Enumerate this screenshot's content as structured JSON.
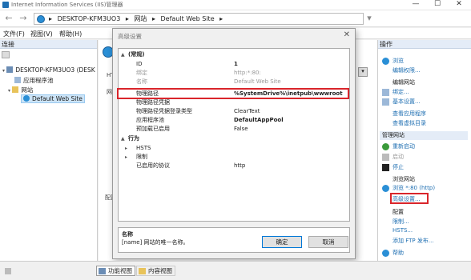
{
  "window": {
    "title": "Internet Information Services (IIS)管理器",
    "minimize": "—",
    "maximize": "☐",
    "close": "✕"
  },
  "address": {
    "back": "←",
    "forward": "→",
    "sep": "▸",
    "crumbs": [
      "DESKTOP-KFM3UO3",
      "网站",
      "Default Web Site"
    ],
    "dropdown": "▾"
  },
  "menu": [
    "文件(F)",
    "视图(V)",
    "帮助(H)"
  ],
  "left": {
    "header": "连接",
    "tree": [
      "DESKTOP-KFM3UO3 (DESK",
      "应用程序池",
      "网站",
      "Default Web Site"
    ]
  },
  "middle": {
    "label_htt": "HTT",
    "label_pei": "配置",
    "label_yu": "网"
  },
  "dialog": {
    "title": "高级设置",
    "close": "✕",
    "rows": [
      {
        "k": "(常规)",
        "v": "",
        "cat": true,
        "t": "▲"
      },
      {
        "k": "ID",
        "v": "1"
      },
      {
        "k": "绑定",
        "v": "http:*:80:"
      },
      {
        "k": "名称",
        "v": "Default Web Site"
      },
      {
        "k": "物理路径",
        "v": "%SystemDrive%\\inetpub\\wwwroot"
      },
      {
        "k": "物理路径凭据",
        "v": ""
      },
      {
        "k": "物理路径凭据登录类型",
        "v": "ClearText"
      },
      {
        "k": "应用程序池",
        "v": "DefaultAppPool"
      },
      {
        "k": "预加载已启用",
        "v": "False"
      },
      {
        "k": "行为",
        "v": "",
        "cat": true,
        "t": "▲"
      },
      {
        "k": "HSTS",
        "v": "",
        "t": "▸"
      },
      {
        "k": "限制",
        "v": "",
        "t": "▸"
      },
      {
        "k": "已启用的协议",
        "v": "http"
      }
    ],
    "desc_title": "名称",
    "desc_text": "[name] 网站的唯一名称。",
    "ok": "确定",
    "cancel": "取消"
  },
  "right": {
    "header": "操作",
    "items": [
      {
        "text": "浏览",
        "link": true
      },
      {
        "text": "编辑权限...",
        "link": true
      },
      {
        "text": "编辑网站",
        "link": false
      },
      {
        "text": "绑定...",
        "link": true
      },
      {
        "text": "基本设置...",
        "link": true
      },
      {
        "text": "查看应用程序",
        "link": true
      },
      {
        "text": "查看虚拟目录",
        "link": true
      }
    ],
    "manage_header": "管理网站",
    "manage": [
      {
        "text": "重新启动",
        "link": true
      },
      {
        "text": "启动",
        "link": false
      },
      {
        "text": "停止",
        "link": true
      }
    ],
    "browse_head": "浏览网站",
    "browse_link": "浏览 *:80 (http)",
    "advanced": "高级设置...",
    "config_head": "配置",
    "config": [
      "限制...",
      "HSTS...",
      "添加 FTP 发布..."
    ],
    "help": "帮助"
  },
  "status": {
    "features": "功能视图",
    "content": "内容视图"
  }
}
